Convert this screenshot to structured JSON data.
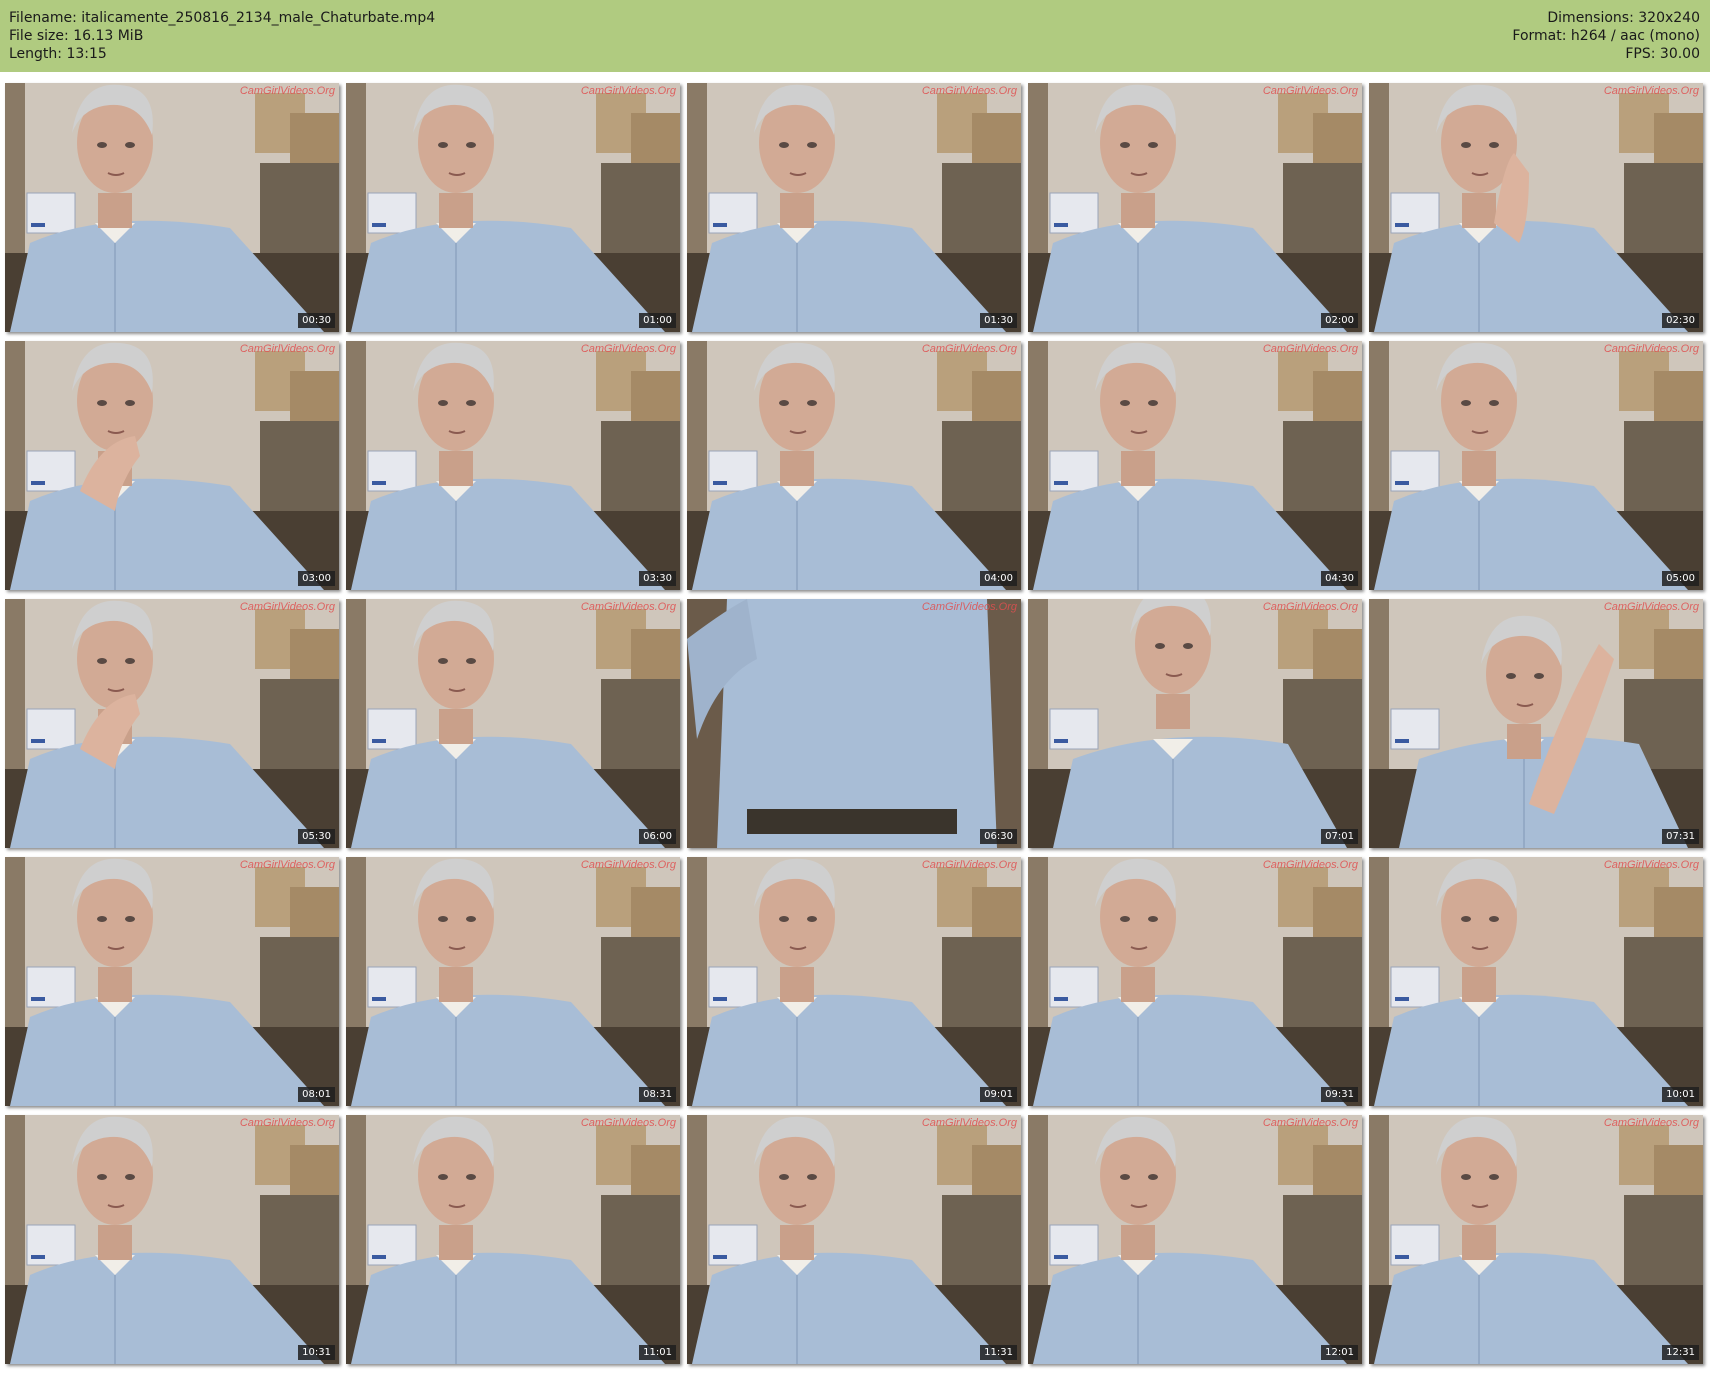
{
  "header": {
    "filename_line": "Filename: italicamente_250816_2134_male_Chaturbate.mp4",
    "filesize_line": "File size: 16.13 MiB",
    "length_line": "Length: 13:15",
    "dimensions_line": "Dimensions: 320x240",
    "format_line": "Format: h264 / aac (mono)",
    "fps_line": "FPS: 30.00"
  },
  "colors": {
    "header_bg": "#b0cb80",
    "shirt": "#a8bdd6",
    "wall": "#cfc6bb"
  },
  "watermark_text": "CamGirlVideos.Org",
  "thumbnails": [
    {
      "time": "00:30",
      "pose": "normal"
    },
    {
      "time": "01:00",
      "pose": "normal"
    },
    {
      "time": "01:30",
      "pose": "normal"
    },
    {
      "time": "02:00",
      "pose": "normal"
    },
    {
      "time": "02:30",
      "pose": "hand-cheek"
    },
    {
      "time": "03:00",
      "pose": "hand-chin"
    },
    {
      "time": "03:30",
      "pose": "normal"
    },
    {
      "time": "04:00",
      "pose": "normal"
    },
    {
      "time": "04:30",
      "pose": "normal"
    },
    {
      "time": "05:00",
      "pose": "normal"
    },
    {
      "time": "05:30",
      "pose": "hand-chin"
    },
    {
      "time": "06:00",
      "pose": "normal"
    },
    {
      "time": "06:30",
      "pose": "torso"
    },
    {
      "time": "07:01",
      "pose": "low"
    },
    {
      "time": "07:31",
      "pose": "side"
    },
    {
      "time": "08:01",
      "pose": "normal"
    },
    {
      "time": "08:31",
      "pose": "normal"
    },
    {
      "time": "09:01",
      "pose": "normal"
    },
    {
      "time": "09:31",
      "pose": "normal"
    },
    {
      "time": "10:01",
      "pose": "normal"
    },
    {
      "time": "10:31",
      "pose": "normal"
    },
    {
      "time": "11:01",
      "pose": "normal"
    },
    {
      "time": "11:31",
      "pose": "normal"
    },
    {
      "time": "12:01",
      "pose": "normal"
    },
    {
      "time": "12:31",
      "pose": "normal"
    }
  ]
}
